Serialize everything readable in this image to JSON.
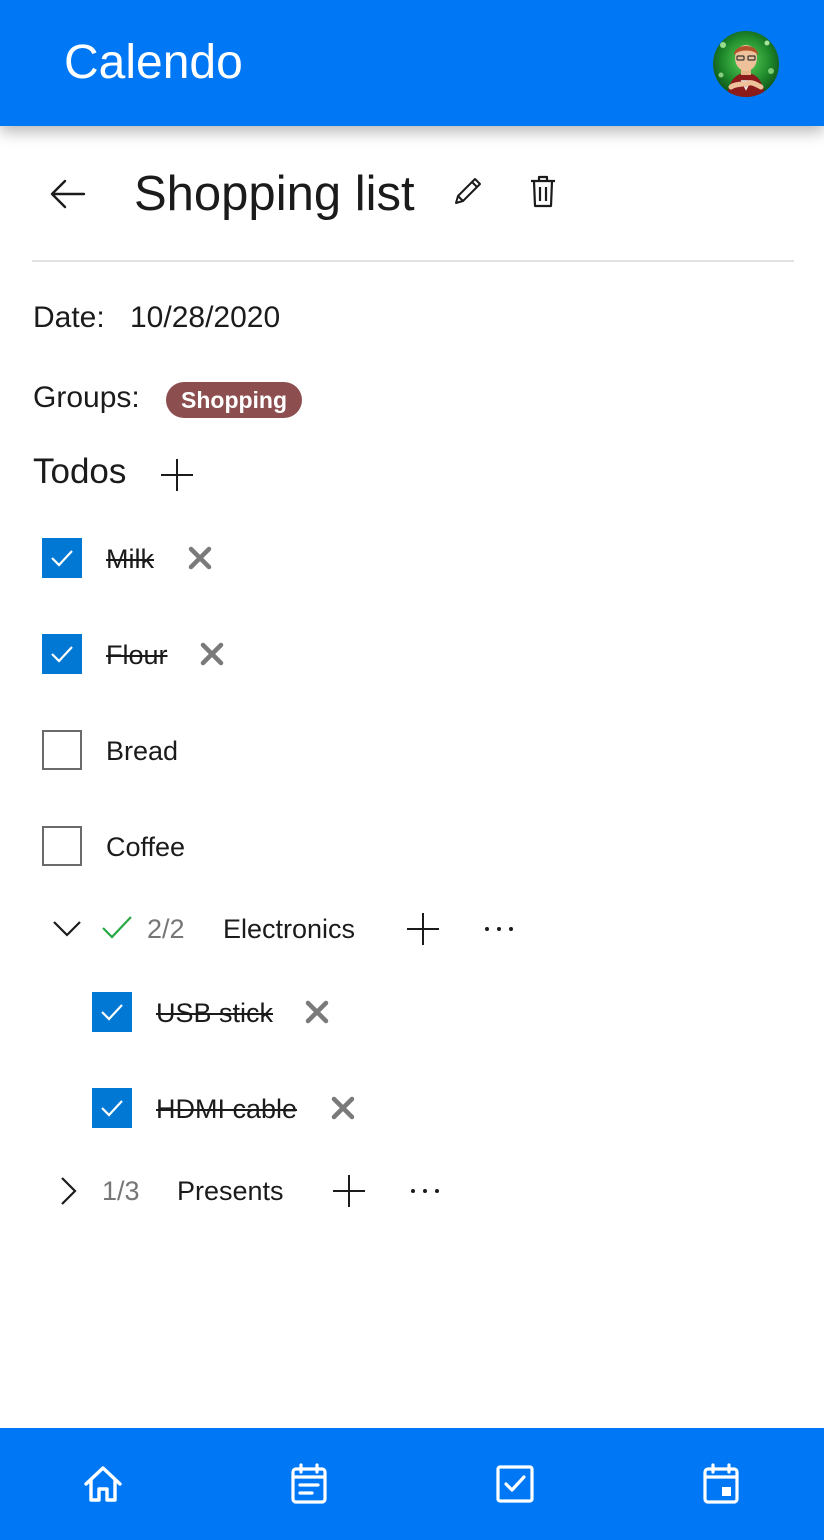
{
  "app": {
    "title": "Calendo",
    "accent": "#0078f5",
    "checkbox_color": "#0078d4"
  },
  "header": {
    "title": "Shopping list",
    "back_icon": "arrow-left-icon",
    "edit_icon": "pencil-icon",
    "delete_icon": "trash-icon"
  },
  "details": {
    "date_label": "Date:",
    "date_value": "10/28/2020",
    "groups_label": "Groups:",
    "group_chip": "Shopping",
    "group_chip_color": "#8c4e4e"
  },
  "todos": {
    "title": "Todos",
    "items": [
      {
        "label": "Milk",
        "checked": true
      },
      {
        "label": "Flour",
        "checked": true
      },
      {
        "label": "Bread",
        "checked": false
      },
      {
        "label": "Coffee",
        "checked": false
      }
    ],
    "groups": [
      {
        "name": "Electronics",
        "progress": "2/2",
        "expanded": true,
        "complete": true,
        "items": [
          {
            "label": "USB stick",
            "checked": true
          },
          {
            "label": "HDMI cable",
            "checked": true
          }
        ]
      },
      {
        "name": "Presents",
        "progress": "1/3",
        "expanded": false,
        "complete": false
      }
    ]
  },
  "bottom_nav": [
    {
      "icon": "home-icon"
    },
    {
      "icon": "notes-icon"
    },
    {
      "icon": "todo-checkbox-icon"
    },
    {
      "icon": "calendar-icon"
    }
  ]
}
